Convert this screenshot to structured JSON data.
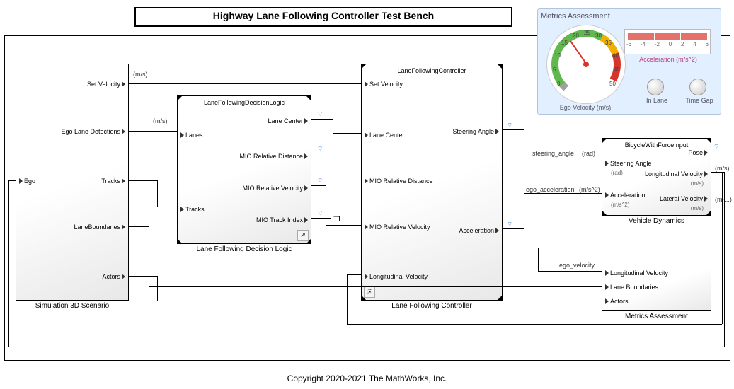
{
  "title": "Highway Lane Following Controller Test Bench",
  "copyright": "Copyright 2020-2021 The MathWorks, Inc.",
  "blocks": {
    "scenario": {
      "label": "Simulation 3D Scenario",
      "in": [
        "Ego"
      ],
      "out": [
        "Set Velocity",
        "Ego Lane Detections",
        "Tracks",
        "LaneBoundaries",
        "Actors"
      ]
    },
    "decision": {
      "title": "LaneFollowingDecisionLogic",
      "label": "Lane Following Decision Logic",
      "in": [
        "Lanes",
        "Tracks"
      ],
      "out": [
        "Lane Center",
        "MIO Relative Distance",
        "MIO Relative Velocity",
        "MIO Track Index"
      ]
    },
    "controller": {
      "title": "LaneFollowingController",
      "label": "Lane Following Controller",
      "in": [
        "Set Velocity",
        "Lane Center",
        "MIO Relative Distance",
        "MIO Relative Velocity",
        "Longitudinal Velocity"
      ],
      "out": [
        "Steering Angle",
        "Acceleration"
      ]
    },
    "vehicle": {
      "title": "BicycleWithForceInput",
      "label": "Vehicle Dynamics",
      "in": [
        "Steering Angle",
        "Acceleration"
      ],
      "out": [
        "Pose",
        "Longitudinal Velocity",
        "Lateral Velocity"
      ],
      "units": {
        "sa": "(rad)",
        "acc": "(m/s^2)",
        "lv": "(m/s)",
        "latv": "(m/s)"
      }
    },
    "metrics": {
      "label": "Metrics Assessment",
      "in": [
        "Longitudinal Velocity",
        "Lane Boundaries",
        "Actors"
      ]
    }
  },
  "signals": {
    "set_velocity_unit": "(m/s)",
    "ego_lane_unit": "(m/s)",
    "steering_angle": "steering_angle",
    "steering_angle_unit": "(rad)",
    "ego_acceleration": "ego_acceleration",
    "ego_acceleration_unit": "(m/s^2)",
    "ego_velocity": "ego_velocity",
    "pose_unit": "(m/s)",
    "latv_unit": "(m⋅...)"
  },
  "metrics_panel": {
    "title": "Metrics Assessment",
    "gauge_label": "Ego Velocity (m/s)",
    "gauge_ticks": [
      "0",
      "5",
      "10",
      "15",
      "20",
      "25",
      "30",
      "35",
      "40",
      "45",
      "50"
    ],
    "hbar_label": "Acceleration (m/s^2)",
    "hbar_ticks": [
      "-6",
      "-4",
      "-2",
      "0",
      "2",
      "4",
      "6"
    ],
    "lamp1": "In Lane",
    "lamp2": "Time Gap"
  }
}
